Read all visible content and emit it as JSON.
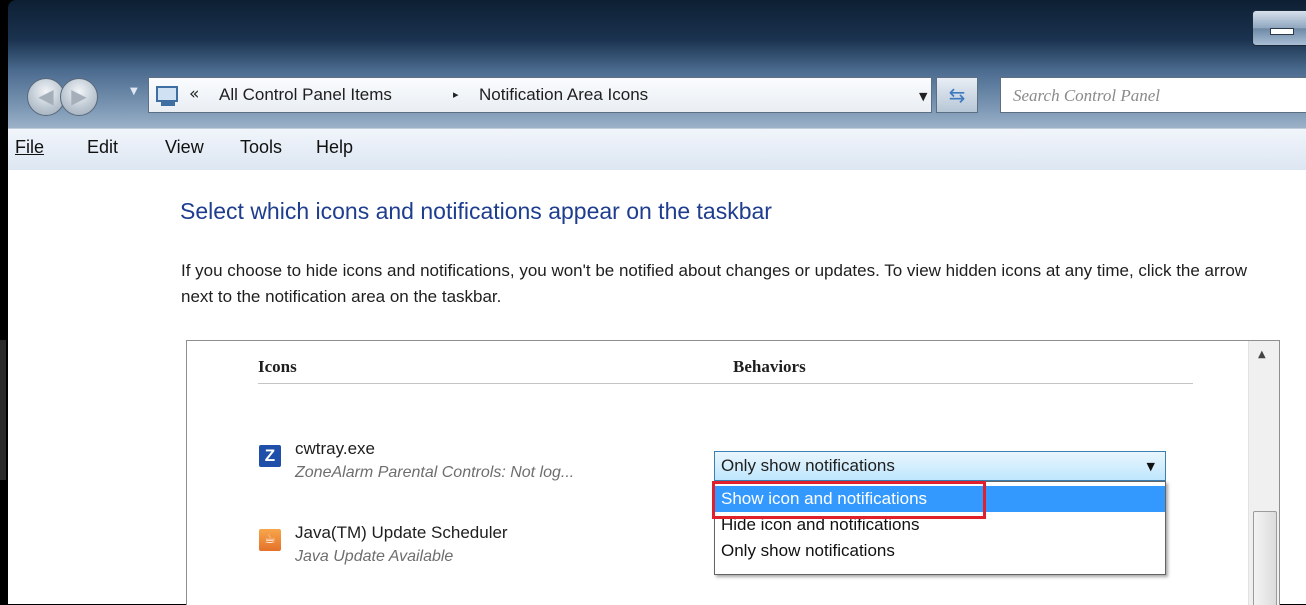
{
  "nav": {
    "back_icon": "back-arrow-icon",
    "forward_icon": "forward-arrow-icon",
    "breadcrumb_chevron": "«",
    "breadcrumb": [
      "All Control Panel Items",
      "Notification Area Icons"
    ],
    "separator": "▸",
    "search_placeholder": "Search Control Panel"
  },
  "menu": [
    "File",
    "Edit",
    "View",
    "Tools",
    "Help"
  ],
  "content": {
    "heading": "Select which icons and notifications appear on the taskbar",
    "description": "If you choose to hide icons and notifications, you won't be notified about changes or updates. To view hidden icons at any time, click the arrow next to the notification area on the taskbar."
  },
  "table": {
    "col_icons": "Icons",
    "col_behaviors": "Behaviors",
    "rows": [
      {
        "name": "cwtray.exe",
        "subtitle": "ZoneAlarm Parental Controls: Not log...",
        "icon": "zonealarm-icon",
        "icon_glyph": "Z"
      },
      {
        "name": "Java(TM) Update Scheduler",
        "subtitle": "Java Update Available",
        "icon": "java-icon",
        "icon_glyph": "☕"
      }
    ]
  },
  "behavior_combo": {
    "selected": "Only show notifications",
    "options": [
      "Show icon and notifications",
      "Hide icon and notifications",
      "Only show notifications"
    ],
    "highlighted_option": "Show icon and notifications"
  },
  "colors": {
    "heading": "#1e3d8f",
    "selection": "#3399ff",
    "annotation_box": "#e0202c"
  }
}
